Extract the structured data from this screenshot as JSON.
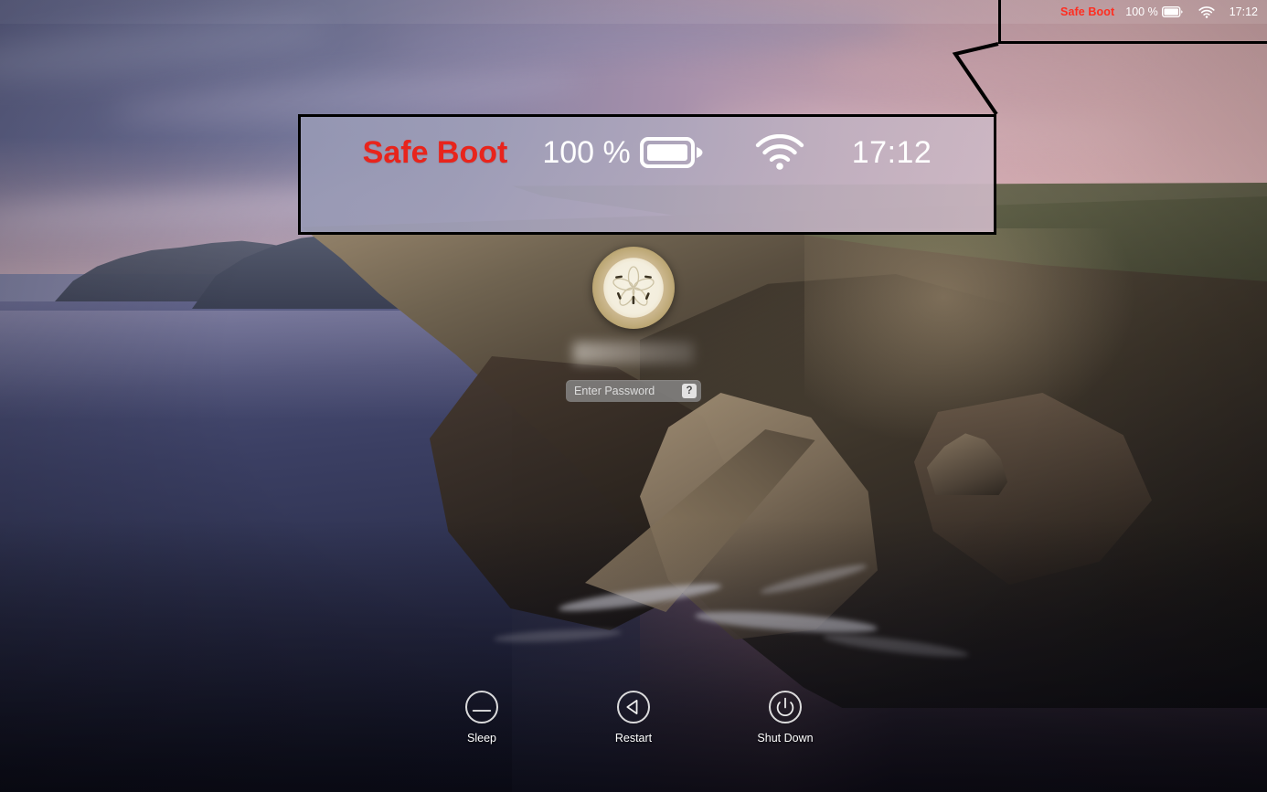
{
  "menubar": {
    "safe_boot_label": "Safe Boot",
    "safe_boot_color": "#ff2d20",
    "battery_percent": "100 %",
    "battery_icon": "battery-full-icon",
    "wifi_icon": "wifi-full-icon",
    "clock": "17:12"
  },
  "callout": {
    "magnified": {
      "safe_boot_label": "Safe Boot",
      "safe_boot_color": "#e8241c",
      "battery_percent": "100 %",
      "battery_icon": "battery-full-icon",
      "wifi_icon": "wifi-full-icon",
      "clock": "17:12"
    },
    "border_color": "#000000"
  },
  "login": {
    "avatar_icon": "sand-dollar-avatar",
    "username": "",
    "username_redacted": true,
    "password": {
      "value": "",
      "placeholder": "Enter Password",
      "hint_button_label": "?"
    }
  },
  "actions": [
    {
      "label": "Sleep",
      "icon": "sleep-icon"
    },
    {
      "label": "Restart",
      "icon": "restart-icon"
    },
    {
      "label": "Shut Down",
      "icon": "power-icon"
    }
  ]
}
